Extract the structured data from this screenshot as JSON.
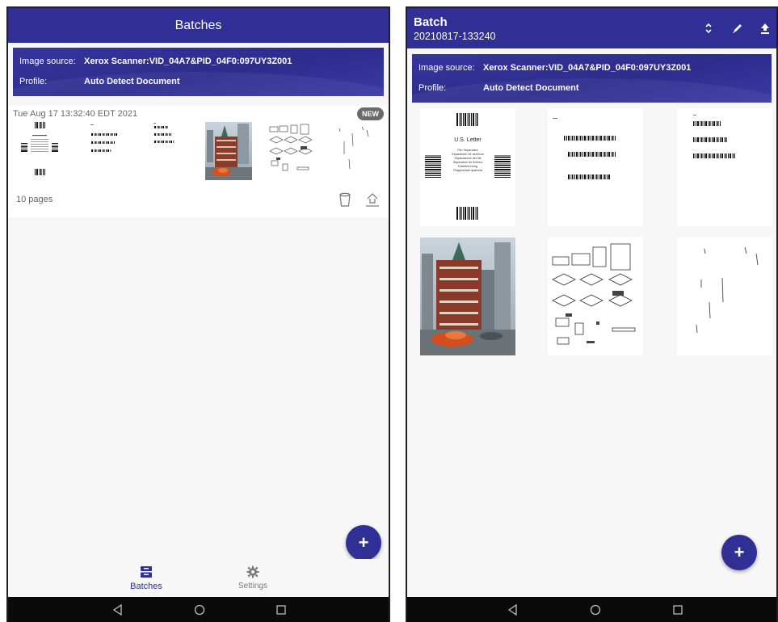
{
  "colors": {
    "primary": "#2f2f95",
    "badge": "#6a6a6a",
    "system_bar": "#0a0a0a"
  },
  "left_screen": {
    "title": "Batches",
    "source": {
      "image_source_label": "Image source:",
      "image_source_value": "Xerox Scanner:VID_04A7&PID_04F0:097UY3Z001",
      "profile_label": "Profile:",
      "profile_value": "Auto Detect Document"
    },
    "batch_card": {
      "date": "Tue Aug 17 13:32:40 EDT 2021",
      "badge": "NEW",
      "pages": "10 pages",
      "thumbnails": [
        "barcode-letter",
        "barcode-page",
        "barcode-page",
        "city-photo",
        "parts-diagram",
        "sparse-marks"
      ],
      "delete_icon": "trash-icon",
      "upload_icon": "upload-icon"
    },
    "fab_label": "+",
    "bottom_nav": [
      {
        "label": "Batches",
        "icon": "inbox-icon",
        "active": true
      },
      {
        "label": "Settings",
        "icon": "gear-icon",
        "active": false
      }
    ]
  },
  "right_screen": {
    "title": "Batch",
    "subtitle": "20210817-133240",
    "actions": [
      "sort-icon",
      "pencil-icon",
      "upload-icon"
    ],
    "source": {
      "image_source_label": "Image source:",
      "image_source_value": "Xerox Scanner:VID_04A7&PID_04F0:097UY3Z001",
      "profile_label": "Profile:",
      "profile_value": "Auto Detect Document"
    },
    "letter_page": {
      "heading": "U.S. Letter",
      "lines": [
        "File Separation",
        "Separación de archivos",
        "Separazione dei file",
        "Separation de fichiers",
        "Dateitrennung",
        "Разделение файлов"
      ]
    },
    "pages": [
      "barcode-letter",
      "barcode-page",
      "barcode-page",
      "city-photo",
      "parts-diagram",
      "sparse-marks"
    ],
    "fab_label": "+"
  },
  "system_nav": [
    "back-icon",
    "home-icon",
    "recents-icon"
  ]
}
